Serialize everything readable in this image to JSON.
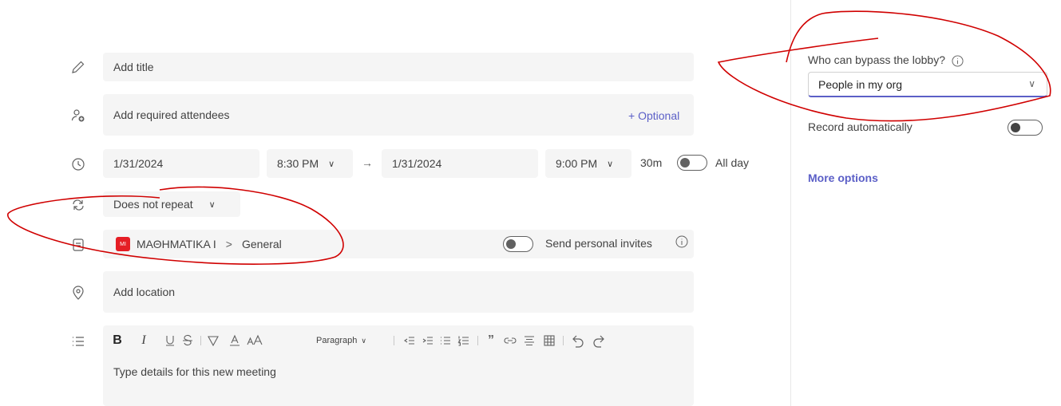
{
  "title_field": {
    "placeholder": "Add title"
  },
  "attendees_field": {
    "placeholder": "Add required attendees",
    "optional_label": "+ Optional"
  },
  "schedule": {
    "start_date": "1/31/2024",
    "start_time": "8:30 PM",
    "arrow": "→",
    "end_date": "1/31/2024",
    "end_time": "9:00 PM",
    "duration": "30m",
    "all_day_label": "All day"
  },
  "repeat": {
    "value": "Does not repeat"
  },
  "channel": {
    "team_badge": "MI",
    "team_name": "ΜΑΘΗΜΑΤΙΚΑ Ι",
    "separator": ">",
    "channel_name": "General",
    "send_invites_label": "Send personal invites"
  },
  "location_field": {
    "placeholder": "Add location"
  },
  "toolbar": {
    "bold": "B",
    "italic": "I",
    "paragraph_label": "Paragraph"
  },
  "details_field": {
    "placeholder": "Type details for this new meeting"
  },
  "sidebar": {
    "lobby_label": "Who can bypass the lobby?",
    "lobby_value": "People in my org",
    "record_label": "Record automatically",
    "more_options": "More options"
  },
  "colors": {
    "accent": "#5b5fc7",
    "team_badge": "#e51e25",
    "annotation": "#d00000"
  }
}
